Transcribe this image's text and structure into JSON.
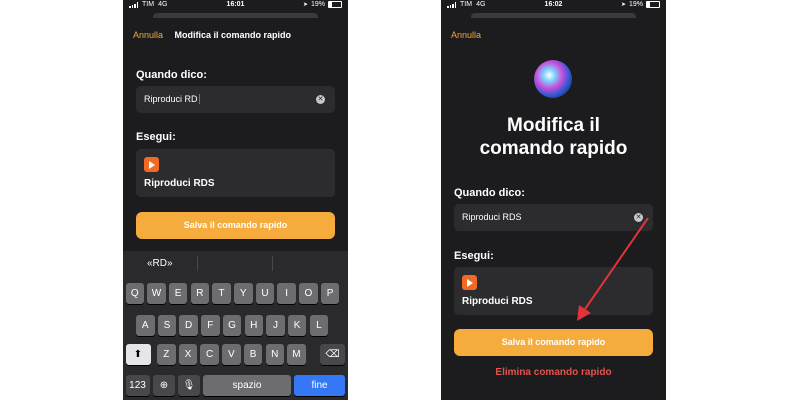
{
  "left": {
    "status": {
      "carrier": "TIM",
      "network": "4G",
      "time": "16:01",
      "battery": "19%"
    },
    "nav": {
      "cancel": "Annulla",
      "title": "Modifica il comando rapido"
    },
    "phrase_label": "Quando dico:",
    "phrase_value": "Riproduci RD",
    "action_label": "Esegui:",
    "action_name": "Riproduci RDS",
    "save": "Salva il comando rapido",
    "keyboard": {
      "suggestion": "«RD»",
      "row1": [
        "Q",
        "W",
        "E",
        "R",
        "T",
        "Y",
        "U",
        "I",
        "O",
        "P"
      ],
      "row2": [
        "A",
        "S",
        "D",
        "F",
        "G",
        "H",
        "J",
        "K",
        "L"
      ],
      "row3": [
        "Z",
        "X",
        "C",
        "V",
        "B",
        "N",
        "M"
      ],
      "numbers": "123",
      "space": "spazio",
      "done": "fine",
      "shift_glyph": "⬆",
      "delete_glyph": "⌫",
      "globe_glyph": "⊕",
      "mic_glyph": "🎙"
    }
  },
  "right": {
    "status": {
      "carrier": "TIM",
      "network": "4G",
      "time": "16:02",
      "battery": "19%"
    },
    "nav": {
      "cancel": "Annulla"
    },
    "title_line1": "Modifica il",
    "title_line2": "comando rapido",
    "phrase_label": "Quando dico:",
    "phrase_value": "Riproduci RDS",
    "action_label": "Esegui:",
    "action_name": "Riproduci RDS",
    "save": "Salva il comando rapido",
    "delete": "Elimina comando rapido"
  },
  "colors": {
    "accent": "#f5ac3c",
    "danger": "#e5524c",
    "keyboard_blue": "#3478f6",
    "arrow": "#e0343a"
  }
}
